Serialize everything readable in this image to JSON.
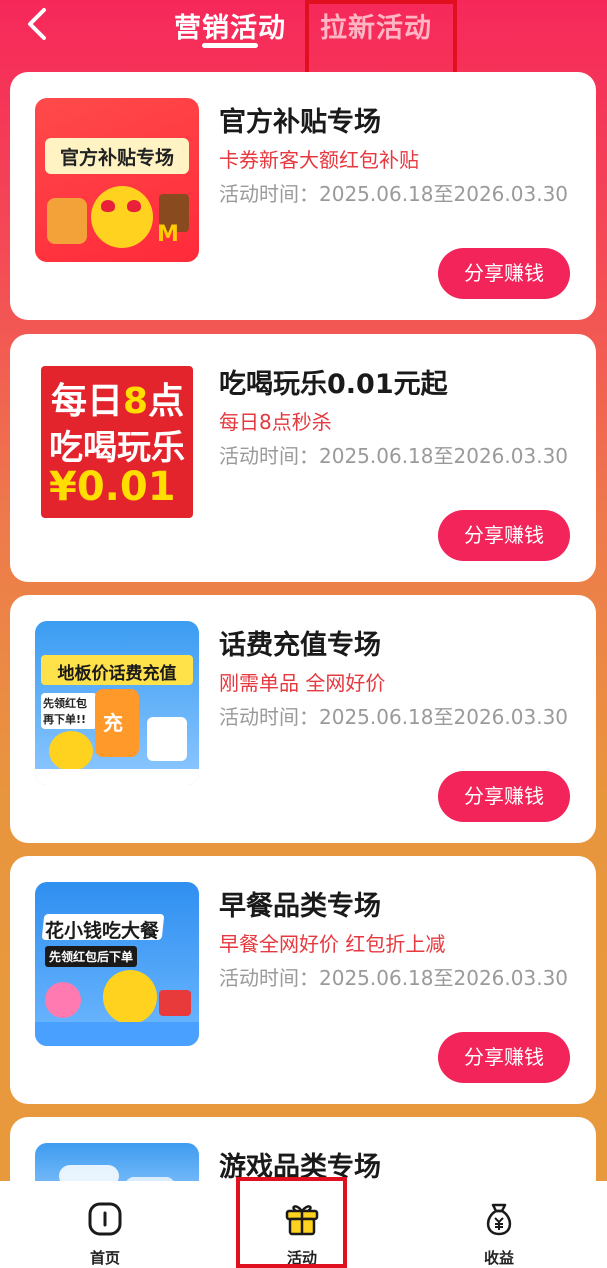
{
  "header": {
    "tabs": [
      "营销活动",
      "拉新活动"
    ]
  },
  "thumbs": {
    "official_subsidy": "官方补贴专场",
    "daily_8": [
      "每日",
      "8",
      "点",
      "吃喝玩乐",
      "¥0.01"
    ],
    "phone_recharge": [
      "地板价话费充值",
      "先领红包再下单!!",
      "充"
    ],
    "breakfast": [
      "花小钱吃大餐",
      "先领红包后下单"
    ]
  },
  "cards": [
    {
      "title": "官方补贴专场",
      "subtitle": "卡券新客大额红包补贴",
      "time": "活动时间：2025.06.18至2026.03.30",
      "button": "分享赚钱"
    },
    {
      "title": "吃喝玩乐0.01元起",
      "subtitle": "每日8点秒杀",
      "time": "活动时间：2025.06.18至2026.03.30",
      "button": "分享赚钱"
    },
    {
      "title": "话费充值专场",
      "subtitle": "刚需单品 全网好价",
      "time": "活动时间：2025.06.18至2026.03.30",
      "button": "分享赚钱"
    },
    {
      "title": "早餐品类专场",
      "subtitle": "早餐全网好价 红包折上减",
      "time": "活动时间：2025.06.18至2026.03.30",
      "button": "分享赚钱"
    },
    {
      "title": "游戏品类专场"
    }
  ],
  "bottom_nav": [
    {
      "label": "首页",
      "icon": "home-icon"
    },
    {
      "label": "活动",
      "icon": "gift-icon"
    },
    {
      "label": "收益",
      "icon": "money-bag-icon"
    }
  ],
  "colors": {
    "accent": "#f2245a",
    "subtitle": "#e5393f",
    "annotation": "#e01020"
  }
}
